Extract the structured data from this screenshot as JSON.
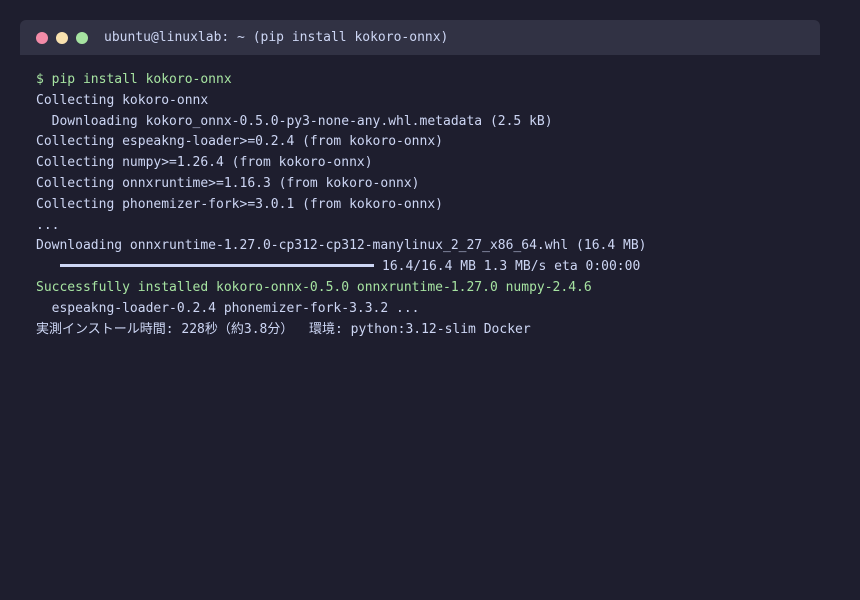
{
  "window": {
    "title": "ubuntu@linuxlab: ~ (pip install kokoro-onnx)"
  },
  "terminal": {
    "lines": [
      "$ pip install kokoro-onnx",
      "Collecting kokoro-onnx",
      "  Downloading kokoro_onnx-0.5.0-py3-none-any.whl.metadata (2.5 kB)",
      "Collecting espeakng-loader>=0.2.4 (from kokoro-onnx)",
      "Collecting numpy>=1.26.4 (from kokoro-onnx)",
      "Collecting onnxruntime>=1.16.3 (from kokoro-onnx)",
      "Collecting phonemizer-fork>=3.0.1 (from kokoro-onnx)",
      "...",
      "Downloading onnxruntime-1.27.0-cp312-cp312-manylinux_2_27_x86_64.whl (16.4 MB)",
      "16.4/16.4 MB 1.3 MB/s eta 0:00:00",
      "Successfully installed kokoro-onnx-0.5.0 onnxruntime-1.27.0 numpy-2.4.6",
      "  espeakng-loader-0.2.4 phonemizer-fork-3.3.2 ...",
      "実測インストール時間: 228秒（約3.8分）  環境: python:3.12-slim Docker"
    ],
    "progress": 1.0
  },
  "colors": {
    "background": "#1e1e2e",
    "titlebar": "#313244",
    "text": "#cdd6f4",
    "success": "#a6e3a1",
    "dot_close": "#f38ba8",
    "dot_minimize": "#f9e2af",
    "dot_maximize": "#a6e3a1"
  }
}
